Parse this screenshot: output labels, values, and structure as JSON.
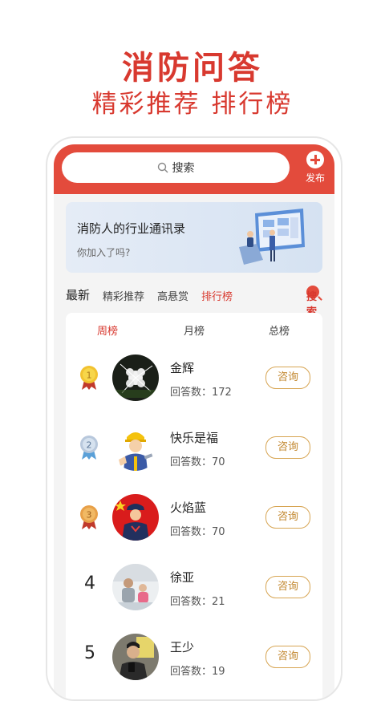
{
  "promo": {
    "title": "消防问答",
    "subtitle": "精彩推荐 排行榜"
  },
  "topbar": {
    "search_label": "搜索",
    "publish_label": "发布"
  },
  "banner": {
    "title": "消防人的行业通讯录",
    "subtitle": "你加入了吗?"
  },
  "nav": {
    "items": [
      "最新",
      "精彩推荐",
      "高悬赏",
      "排行榜"
    ],
    "active": "排行榜",
    "search_label": "搜索"
  },
  "rank_tabs": {
    "items": [
      "周榜",
      "月榜",
      "总榜"
    ],
    "active": "周榜"
  },
  "count_label": "回答数：",
  "consult_label": "咨询",
  "colors": {
    "accent": "#e34b3c",
    "gold": "#d7a553"
  },
  "users": [
    {
      "rank": "1",
      "name": "金辉",
      "count": "172",
      "medal": "gold"
    },
    {
      "rank": "2",
      "name": "快乐是福",
      "count": "70",
      "medal": "silver"
    },
    {
      "rank": "3",
      "name": "火焰蓝",
      "count": "70",
      "medal": "bronze"
    },
    {
      "rank": "4",
      "name": "徐亚",
      "count": "21"
    },
    {
      "rank": "5",
      "name": "王少",
      "count": "19"
    }
  ]
}
